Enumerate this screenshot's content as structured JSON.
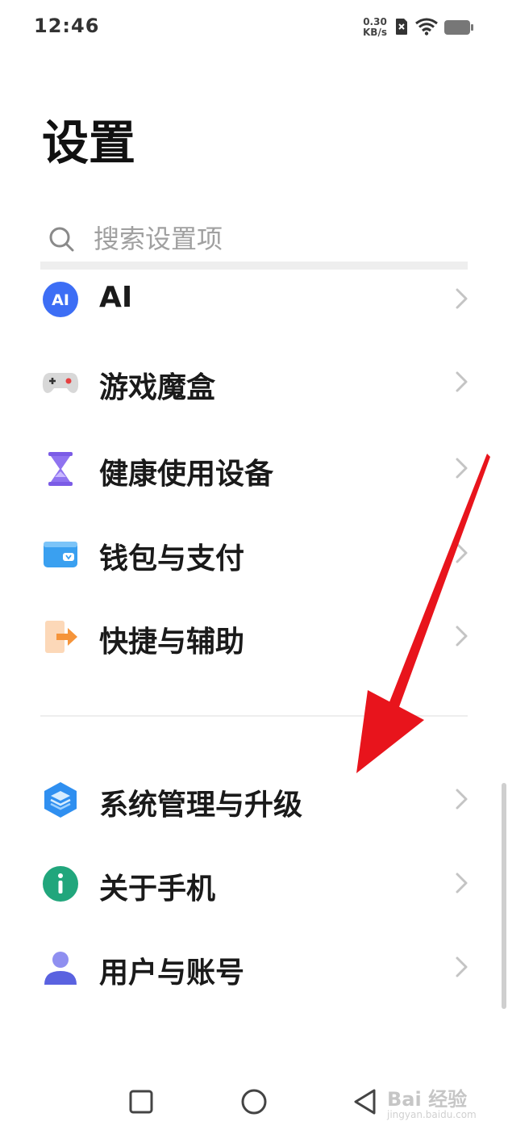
{
  "status_bar": {
    "time": "12:46",
    "net_speed_value": "0.30",
    "net_speed_unit": "KB/s",
    "icons": [
      "sim-off-icon",
      "wifi-icon",
      "battery-icon"
    ]
  },
  "page": {
    "title": "设置"
  },
  "search": {
    "placeholder": "搜索设置项",
    "value": ""
  },
  "settings": {
    "items": [
      {
        "label": "AI",
        "icon": "ai-icon",
        "color": "#3d6ef5"
      },
      {
        "label": "游戏魔盒",
        "icon": "gamepad-icon",
        "color": "#d6d6d6"
      },
      {
        "label": "健康使用设备",
        "icon": "hourglass-icon",
        "color": "#7b5ce6"
      },
      {
        "label": "钱包与支付",
        "icon": "wallet-icon",
        "color": "#3aa0f0"
      },
      {
        "label": "快捷与辅助",
        "icon": "shortcut-icon",
        "color": "#f5a043"
      },
      {
        "label": "系统管理与升级",
        "icon": "system-layers-icon",
        "color": "#2f8ff0"
      },
      {
        "label": "关于手机",
        "icon": "info-icon",
        "color": "#21a67c"
      },
      {
        "label": "用户与账号",
        "icon": "user-icon",
        "color": "#5a62e0"
      }
    ]
  },
  "annotation": {
    "arrow_color": "#e8141c"
  },
  "nav_bar": {
    "icons": [
      "recent-apps-icon",
      "home-icon",
      "back-icon"
    ]
  },
  "watermark": {
    "text": "Bai 经验",
    "url": "jingyan.baidu.com"
  }
}
